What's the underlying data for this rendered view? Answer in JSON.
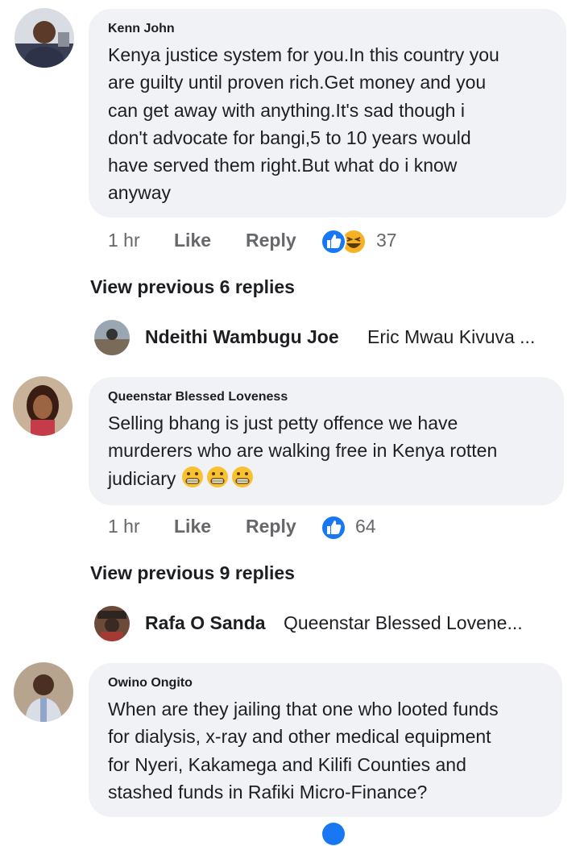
{
  "comments": [
    {
      "author": "Kenn John",
      "text": "Kenya justice system for you.In this country you\nare guilty until proven rich.Get money and you\ncan get away with anything.It's sad though i\ndon't advocate for bangi,5 to 10 years would\nhave served them right.But what do i know\nanyway",
      "time": "1 hr",
      "like_label": "Like",
      "reply_label": "Reply",
      "reaction_icons": [
        "like-icon",
        "laugh-icon"
      ],
      "reaction_count": "37",
      "view_previous": "View previous 6 replies",
      "latest_reply": {
        "name": "Ndeithi Wambugu Joe",
        "preview": "Eric Mwau Kivuva ..."
      }
    },
    {
      "author": "Queenstar Blessed Loveness",
      "text": "Selling bhang is just petty offence we have\nmurderers who are walking free in Kenya rotten\njudiciary",
      "emojis": [
        "grimace-emoji",
        "grimace-emoji",
        "grimace-emoji"
      ],
      "time": "1 hr",
      "like_label": "Like",
      "reply_label": "Reply",
      "reaction_icons": [
        "like-icon"
      ],
      "reaction_count": "64",
      "view_previous": "View previous 9 replies",
      "latest_reply": {
        "name": "Rafa O Sanda",
        "preview": "Queenstar Blessed Lovene..."
      }
    },
    {
      "author": "Owino Ongito",
      "text": "When are they jailing that one who looted funds\nfor dialysis, x-ray and other medical equipment\nfor Nyeri, Kakamega and Kilifi Counties and\nstashed funds in Rafiki Micro-Finance?"
    }
  ],
  "colors": {
    "bubble_bg": "#f0f2f5",
    "meta_text": "#65676b",
    "like_blue": "#1877f2",
    "haha_yellow": "#f7b125"
  }
}
